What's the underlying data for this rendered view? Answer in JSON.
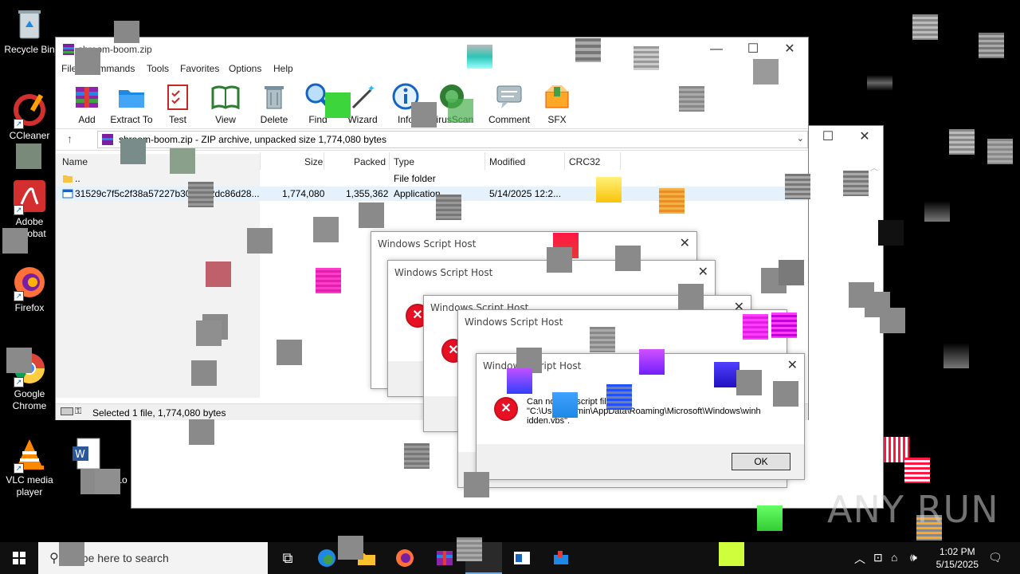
{
  "desktop": {
    "icons": [
      {
        "label": "Recycle Bin",
        "icon": "recycle-bin-icon"
      },
      {
        "label": "CCleaner",
        "icon": "ccleaner-icon"
      },
      {
        "label": "Adobe Acrobat",
        "icon": "adobe-acrobat-icon"
      },
      {
        "label": "Firefox",
        "icon": "firefox-icon"
      },
      {
        "label": "Google Chrome",
        "icon": "chrome-icon"
      },
      {
        "label": "VLC media player",
        "icon": "vlc-icon"
      },
      {
        "label": "Lo",
        "icon": "word-doc-icon"
      },
      {
        "label": "Lo",
        "icon": "generic-file-icon"
      }
    ],
    "watermark": "ANY RUN"
  },
  "winrar": {
    "title": "shroom-boom.zip",
    "menu": [
      "File",
      "Commands",
      "Tools",
      "Favorites",
      "Options",
      "Help"
    ],
    "toolbar": [
      "Add",
      "Extract To",
      "Test",
      "View",
      "Delete",
      "Find",
      "Wizard",
      "Info",
      "VirusScan",
      "Comment",
      "SFX"
    ],
    "address": "shroom-boom.zip - ZIP archive, unpacked size 1,774,080 bytes",
    "columns": {
      "name": "Name",
      "size": "Size",
      "packed": "Packed",
      "type": "Type",
      "modified": "Modified",
      "crc": "CRC32"
    },
    "rows": [
      {
        "name": "..",
        "size": "",
        "packed": "",
        "type": "File folder",
        "modified": ""
      },
      {
        "name": "31529c7f5c2f38a57227b307b...2dc86d28...",
        "size": "1,774,080",
        "packed": "1,355,362",
        "type": "Application",
        "modified": "5/14/2025 12:2..."
      }
    ],
    "status": "Selected 1 file, 1,774,080 bytes"
  },
  "dialogs": {
    "title": "Windows Script Host",
    "message_line1": "Can not find script file",
    "message_line2": "\"C:\\Users\\admin\\AppData\\Roaming\\Microsoft\\Windows\\winh",
    "message_line3": "idden.vbs\".",
    "ok": "OK"
  },
  "taskbar": {
    "search_placeholder": "Type here to search",
    "time": "1:02 PM",
    "date": "5/15/2025"
  }
}
